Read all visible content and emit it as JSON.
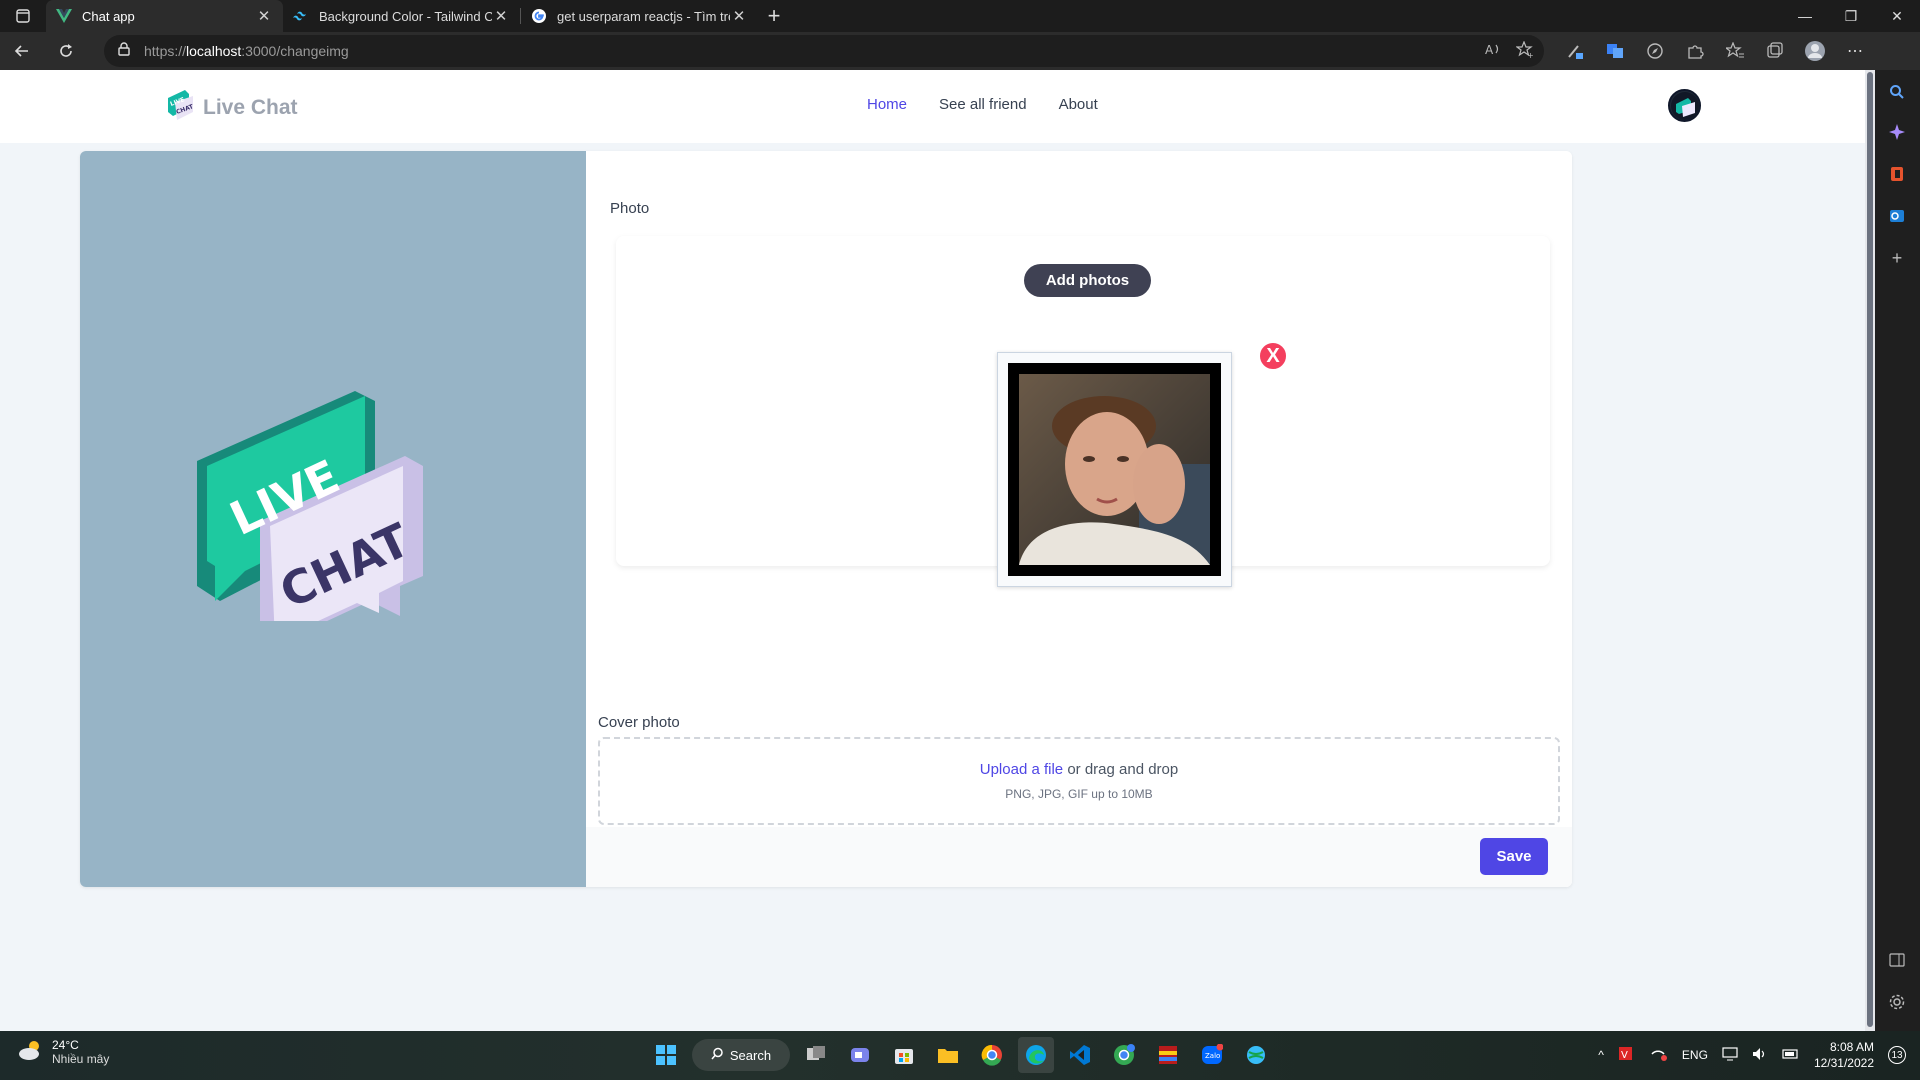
{
  "browser": {
    "tabs": [
      {
        "title": "Chat app",
        "active": true
      },
      {
        "title": "Background Color - Tailwind CSS",
        "active": false
      },
      {
        "title": "get userparam reactjs - Tìm trên",
        "active": false
      }
    ],
    "url_prefix": "https://",
    "url_host": "localhost",
    "url_path": ":3000/changeimg"
  },
  "page": {
    "brand": "Live Chat",
    "nav": [
      {
        "label": "Home",
        "active": true
      },
      {
        "label": "See all friend",
        "active": false
      },
      {
        "label": "About",
        "active": false
      }
    ],
    "hero_text": {
      "line1": "LIVE",
      "line2": "CHAT"
    },
    "photo_label": "Photo",
    "add_photos_label": "Add photos",
    "remove_label": "X",
    "cover_label": "Cover photo",
    "upload_link": "Upload a file",
    "upload_rest": "or drag and drop",
    "upload_hint": "PNG, JPG, GIF up to 10MB",
    "save_label": "Save"
  },
  "taskbar": {
    "temperature": "24°C",
    "weather": "Nhiều mây",
    "search_label": "Search",
    "language": "ENG",
    "time": "8:08 AM",
    "date": "12/31/2022",
    "notifications": "13"
  },
  "colors": {
    "accent": "#4f46e5",
    "hero_bg": "#97b4c6",
    "remove": "#f43f5e",
    "teal": "#1ec9a0"
  }
}
